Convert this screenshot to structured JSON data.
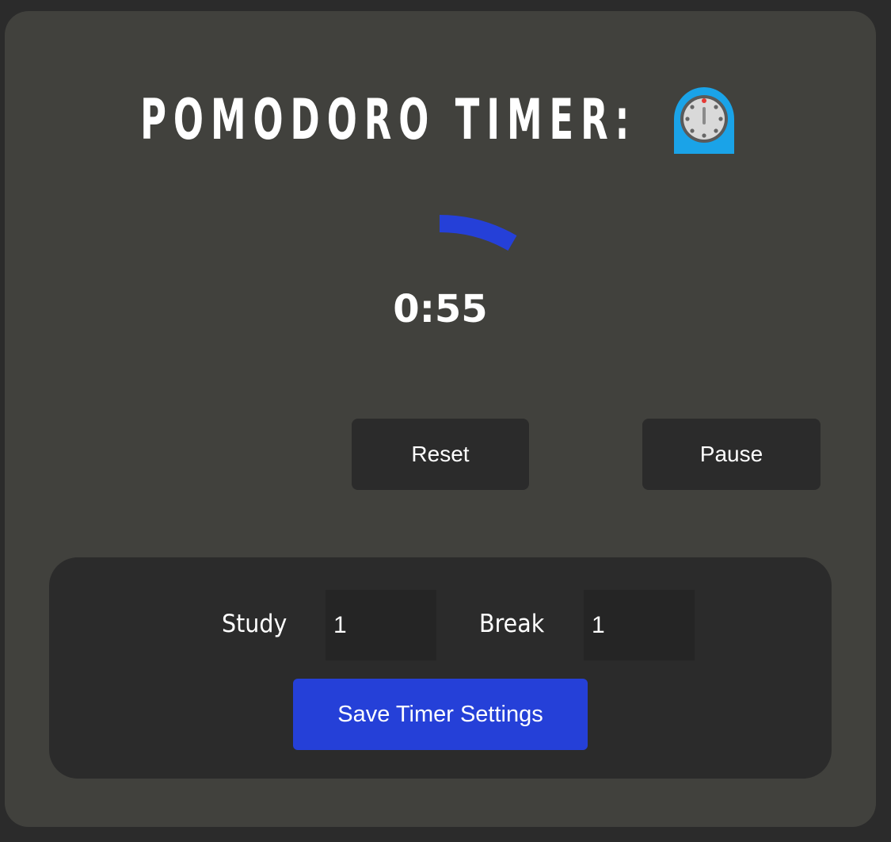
{
  "header": {
    "title": "POMODORO TIMER:",
    "icon": "stopwatch-icon"
  },
  "timer": {
    "time_display": "0:55",
    "remaining_fraction": 0.0833,
    "progress_color": "#2540d8"
  },
  "controls": {
    "reset_label": "Reset",
    "pause_label": "Pause"
  },
  "settings": {
    "study_label": "Study",
    "study_value": "1",
    "break_label": "Break",
    "break_value": "1",
    "save_label": "Save Timer Settings"
  },
  "colors": {
    "background": "#2b2b2b",
    "card": "#41413d",
    "accent": "#2540d8",
    "icon_blue": "#1aa3e8"
  }
}
